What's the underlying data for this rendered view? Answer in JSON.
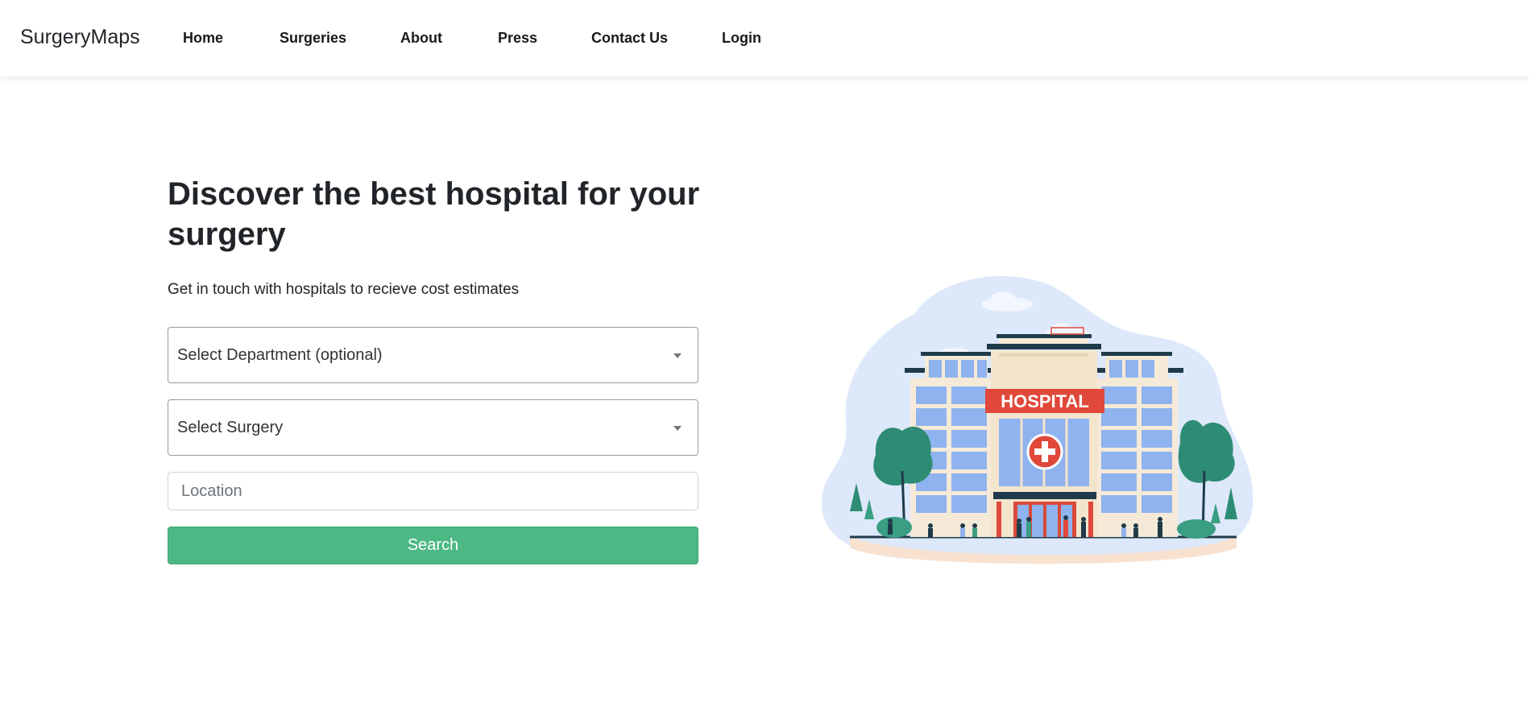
{
  "navbar": {
    "brand": "SurgeryMaps",
    "links": [
      "Home",
      "Surgeries",
      "About",
      "Press",
      "Contact Us",
      "Login"
    ]
  },
  "hero": {
    "title": "Discover the best hospital for your surgery",
    "subtitle": "Get in touch with hospitals to recieve cost estimates"
  },
  "form": {
    "department_select": "Select Department (optional)",
    "surgery_select": "Select Surgery",
    "location_placeholder": "Location",
    "search_label": "Search"
  },
  "illustration": {
    "sign_text": "HOSPITAL",
    "icon": "hospital-building-illustration",
    "colors": {
      "blob": "#dde8fb",
      "building": "#f5ead8",
      "sign": "#e0483a",
      "windows": "#8fb3ee",
      "trees": "#2f8c74",
      "accent_dark": "#1f3b4a"
    }
  },
  "colors": {
    "search_button": "#4cb883",
    "text": "#212529"
  }
}
